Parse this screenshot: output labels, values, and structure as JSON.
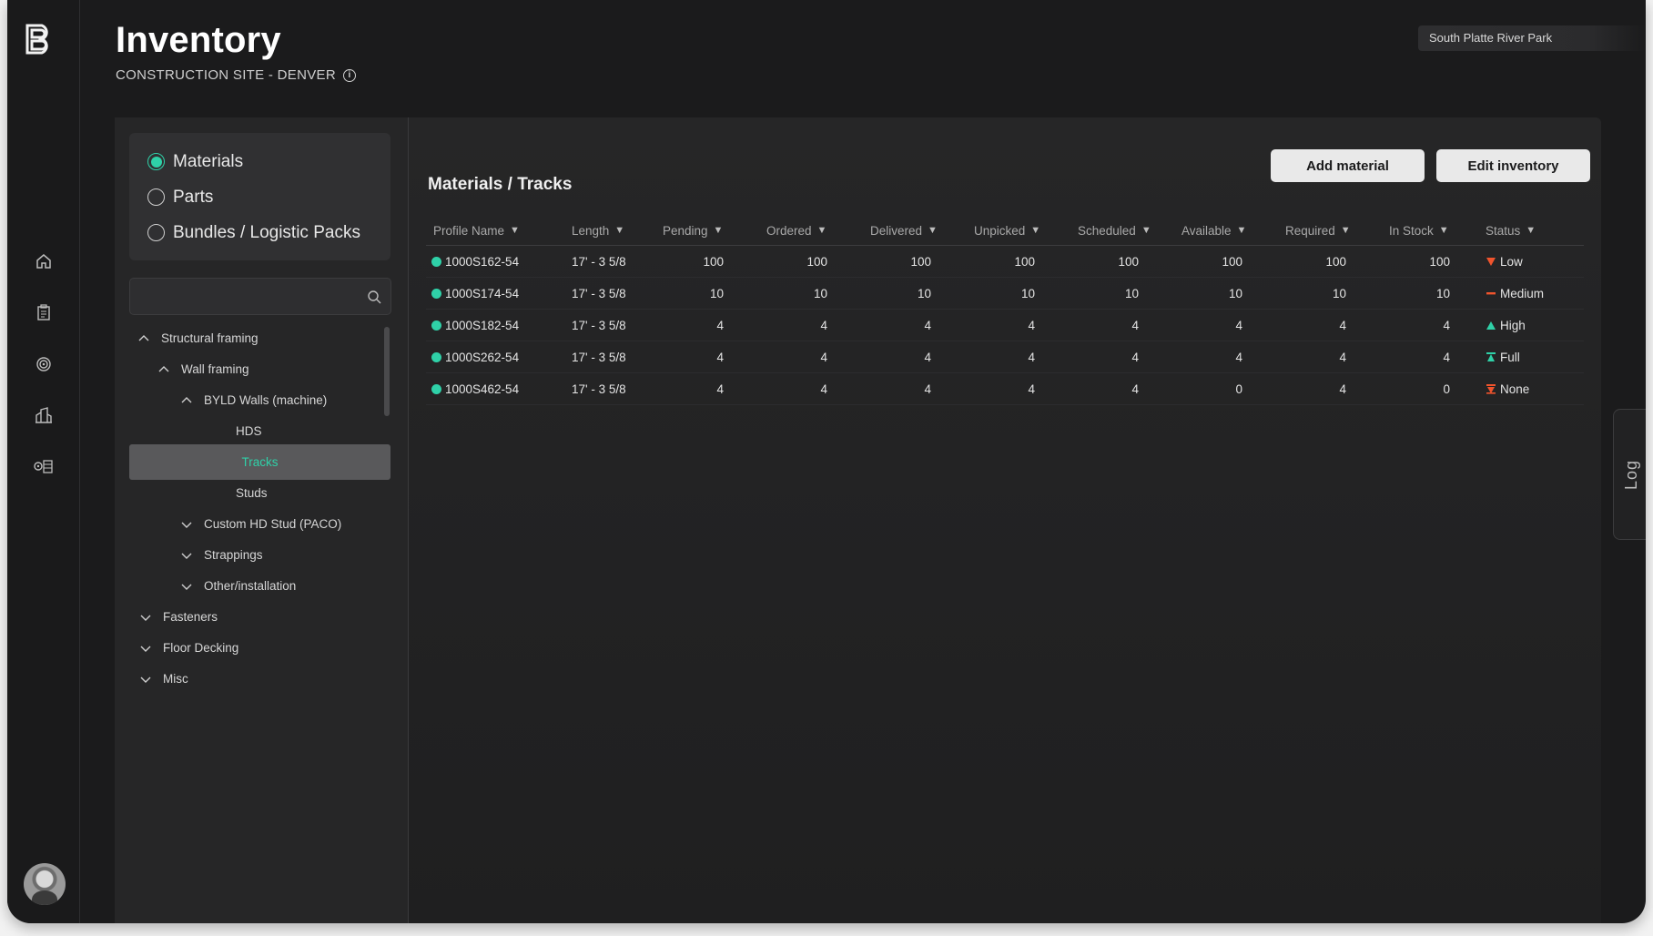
{
  "header": {
    "title": "Inventory",
    "subtitle": "CONSTRUCTION SITE - DENVER",
    "site_selector": "South Platte River Park"
  },
  "rail": {
    "icons": [
      "home-icon",
      "clipboard-icon",
      "target-icon",
      "building-icon",
      "warehouse-icon"
    ]
  },
  "type_selector": {
    "options": [
      {
        "label": "Materials",
        "selected": true
      },
      {
        "label": "Parts",
        "selected": false
      },
      {
        "label": "Bundles / Logistic Packs",
        "selected": false
      }
    ]
  },
  "search": {
    "placeholder": "",
    "value": ""
  },
  "tree": [
    {
      "label": "Structural framing",
      "expanded": true
    },
    {
      "label": "Wall framing",
      "expanded": true
    },
    {
      "label": "BYLD Walls (machine)",
      "expanded": true
    },
    {
      "label": "HDS"
    },
    {
      "label": "Tracks",
      "selected": true
    },
    {
      "label": "Studs"
    },
    {
      "label": "Custom HD Stud (PACO)",
      "expanded": false
    },
    {
      "label": "Strappings",
      "expanded": false
    },
    {
      "label": "Other/installation",
      "expanded": false
    },
    {
      "label": "Fasteners",
      "expanded": false
    },
    {
      "label": "Floor Decking",
      "expanded": false
    },
    {
      "label": "Misc",
      "expanded": false
    }
  ],
  "content": {
    "breadcrumb": "Materials / Tracks",
    "add_button": "Add material",
    "edit_button": "Edit inventory"
  },
  "table": {
    "columns": [
      "Profile Name",
      "Length",
      "Pending",
      "Ordered",
      "Delivered",
      "Unpicked",
      "Scheduled",
      "Available",
      "Required",
      "In Stock",
      "Status"
    ],
    "rows": [
      {
        "name": "1000S162-54",
        "length": "17' - 3 5/8",
        "pending": "100",
        "ordered": "100",
        "delivered": "100",
        "unpicked": "100",
        "scheduled": "100",
        "available": "100",
        "required": "100",
        "in_stock": "100",
        "status": "Low"
      },
      {
        "name": "1000S174-54",
        "length": "17' - 3 5/8",
        "pending": "10",
        "ordered": "10",
        "delivered": "10",
        "unpicked": "10",
        "scheduled": "10",
        "available": "10",
        "required": "10",
        "in_stock": "10",
        "status": "Medium"
      },
      {
        "name": "1000S182-54",
        "length": "17' - 3 5/8",
        "pending": "4",
        "ordered": "4",
        "delivered": "4",
        "unpicked": "4",
        "scheduled": "4",
        "available": "4",
        "required": "4",
        "in_stock": "4",
        "status": "High"
      },
      {
        "name": "1000S262-54",
        "length": "17' - 3 5/8",
        "pending": "4",
        "ordered": "4",
        "delivered": "4",
        "unpicked": "4",
        "scheduled": "4",
        "available": "4",
        "required": "4",
        "in_stock": "4",
        "status": "Full"
      },
      {
        "name": "1000S462-54",
        "length": "17' - 3 5/8",
        "pending": "4",
        "ordered": "4",
        "delivered": "4",
        "unpicked": "4",
        "scheduled": "4",
        "available": "0",
        "required": "4",
        "in_stock": "0",
        "status": "None"
      }
    ]
  },
  "status_colors": {
    "Low": "#f0542d",
    "Medium": "#f0542d",
    "High": "#2fd1a8",
    "Full": "#2fd1a8",
    "None": "#f0542d"
  },
  "colors": {
    "accent": "#2fd1a8",
    "background": "#1b1b1c"
  },
  "log_tab": "Log"
}
